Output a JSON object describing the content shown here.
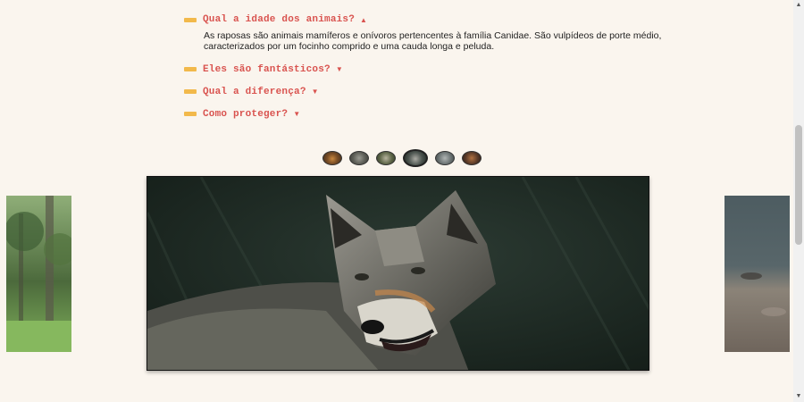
{
  "faq": {
    "items": [
      {
        "question": "Qual a idade dos animais?",
        "expanded": true,
        "answer": "As raposas são animais mamíferos e onívoros pertencentes à família Canidae. São vulpídeos de porte médio, caracterizados por um focinho comprido e uma cauda longa e peluda."
      },
      {
        "question": "Eles são fantásticos?",
        "expanded": false
      },
      {
        "question": "Qual a diferença?",
        "expanded": false
      },
      {
        "question": "Como proteger?",
        "expanded": false
      }
    ],
    "caret_open": "▲",
    "caret_closed": "▼"
  },
  "carousel": {
    "thumbnails": [
      {
        "name": "fox",
        "active": false
      },
      {
        "name": "wolf-grey",
        "active": false
      },
      {
        "name": "wolf-forest",
        "active": false
      },
      {
        "name": "wolf",
        "active": true
      },
      {
        "name": "wolf-rocks",
        "active": false
      },
      {
        "name": "fox-dark",
        "active": false
      }
    ],
    "main_slide": "wolf",
    "left_slide": "forest",
    "right_slide": "rocks"
  },
  "colors": {
    "accent": "#d9534f",
    "bar": "#f2b94b",
    "background": "#faf5ee"
  },
  "scrollbar": {
    "up_icon": "▲",
    "down_icon": "▼"
  }
}
